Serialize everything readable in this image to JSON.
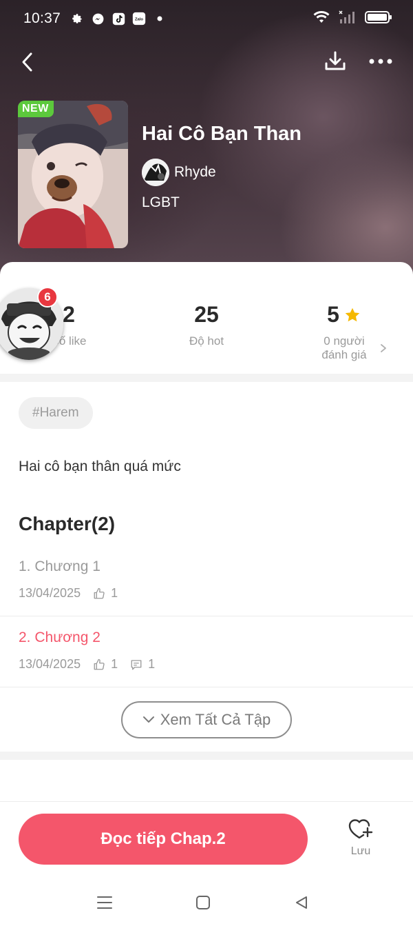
{
  "status_bar": {
    "time": "10:37",
    "icons_left": [
      "settings-icon",
      "messenger-icon",
      "tiktok-icon",
      "zalo-icon",
      "dot-icon"
    ],
    "zalo_text": "Zalo",
    "icons_right": [
      "wifi-icon",
      "signal-icon",
      "battery-icon"
    ]
  },
  "nav": {
    "back_icon": "chevron-left-icon",
    "download_icon": "download-icon",
    "more_icon": "more-horizontal-icon"
  },
  "story": {
    "badge": "NEW",
    "title": "Hai Cô Bạn Than",
    "author": "Rhyde",
    "genre": "LGBT"
  },
  "stats": {
    "likes_value": "2",
    "likes_label": "Số like",
    "hot_value": "25",
    "hot_label": "Độ hot",
    "rating_value": "5",
    "rating_label_line1": "0 người",
    "rating_label_line2": "đánh giá"
  },
  "floating_avatar": {
    "badge_count": "6"
  },
  "tags": [
    "#Harem"
  ],
  "description": "Hai cô bạn thân quá mức",
  "chapters_heading": "Chapter(2)",
  "chapters": [
    {
      "title": "1. Chương 1",
      "date": "13/04/2025",
      "likes": "1",
      "comments": "",
      "status": "read",
      "color": "#9a9a9a"
    },
    {
      "title": "2. Chương 2",
      "date": "13/04/2025",
      "likes": "1",
      "comments": "1",
      "status": "current",
      "color": "#f4566b"
    }
  ],
  "view_all_label": "Xem Tất Cả Tập",
  "bottom_bar": {
    "read_button": "Đọc tiếp Chap.2",
    "save_label": "Lưu"
  },
  "colors": {
    "accent": "#f4566b",
    "new_badge": "#5cc93c",
    "notification": "#e8373f",
    "star": "#f5b800"
  }
}
